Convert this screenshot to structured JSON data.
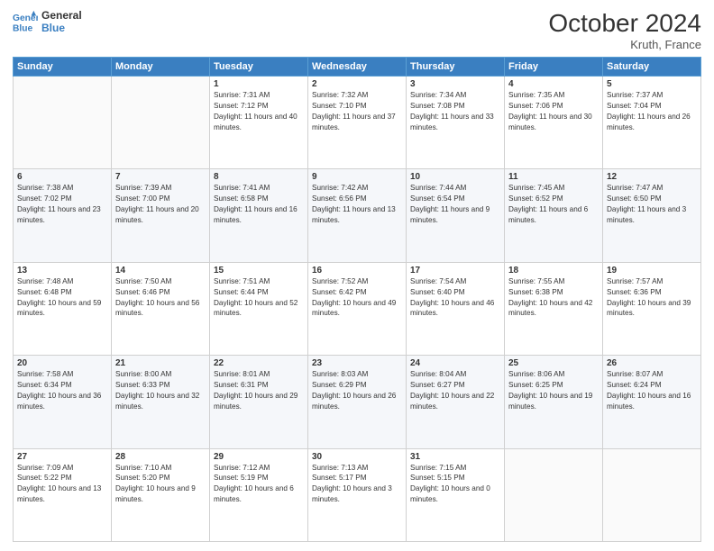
{
  "header": {
    "logo_line1": "General",
    "logo_line2": "Blue",
    "month_title": "October 2024",
    "location": "Kruth, France"
  },
  "weekdays": [
    "Sunday",
    "Monday",
    "Tuesday",
    "Wednesday",
    "Thursday",
    "Friday",
    "Saturday"
  ],
  "weeks": [
    [
      {
        "day": "",
        "info": ""
      },
      {
        "day": "",
        "info": ""
      },
      {
        "day": "1",
        "info": "Sunrise: 7:31 AM\nSunset: 7:12 PM\nDaylight: 11 hours and 40 minutes."
      },
      {
        "day": "2",
        "info": "Sunrise: 7:32 AM\nSunset: 7:10 PM\nDaylight: 11 hours and 37 minutes."
      },
      {
        "day": "3",
        "info": "Sunrise: 7:34 AM\nSunset: 7:08 PM\nDaylight: 11 hours and 33 minutes."
      },
      {
        "day": "4",
        "info": "Sunrise: 7:35 AM\nSunset: 7:06 PM\nDaylight: 11 hours and 30 minutes."
      },
      {
        "day": "5",
        "info": "Sunrise: 7:37 AM\nSunset: 7:04 PM\nDaylight: 11 hours and 26 minutes."
      }
    ],
    [
      {
        "day": "6",
        "info": "Sunrise: 7:38 AM\nSunset: 7:02 PM\nDaylight: 11 hours and 23 minutes."
      },
      {
        "day": "7",
        "info": "Sunrise: 7:39 AM\nSunset: 7:00 PM\nDaylight: 11 hours and 20 minutes."
      },
      {
        "day": "8",
        "info": "Sunrise: 7:41 AM\nSunset: 6:58 PM\nDaylight: 11 hours and 16 minutes."
      },
      {
        "day": "9",
        "info": "Sunrise: 7:42 AM\nSunset: 6:56 PM\nDaylight: 11 hours and 13 minutes."
      },
      {
        "day": "10",
        "info": "Sunrise: 7:44 AM\nSunset: 6:54 PM\nDaylight: 11 hours and 9 minutes."
      },
      {
        "day": "11",
        "info": "Sunrise: 7:45 AM\nSunset: 6:52 PM\nDaylight: 11 hours and 6 minutes."
      },
      {
        "day": "12",
        "info": "Sunrise: 7:47 AM\nSunset: 6:50 PM\nDaylight: 11 hours and 3 minutes."
      }
    ],
    [
      {
        "day": "13",
        "info": "Sunrise: 7:48 AM\nSunset: 6:48 PM\nDaylight: 10 hours and 59 minutes."
      },
      {
        "day": "14",
        "info": "Sunrise: 7:50 AM\nSunset: 6:46 PM\nDaylight: 10 hours and 56 minutes."
      },
      {
        "day": "15",
        "info": "Sunrise: 7:51 AM\nSunset: 6:44 PM\nDaylight: 10 hours and 52 minutes."
      },
      {
        "day": "16",
        "info": "Sunrise: 7:52 AM\nSunset: 6:42 PM\nDaylight: 10 hours and 49 minutes."
      },
      {
        "day": "17",
        "info": "Sunrise: 7:54 AM\nSunset: 6:40 PM\nDaylight: 10 hours and 46 minutes."
      },
      {
        "day": "18",
        "info": "Sunrise: 7:55 AM\nSunset: 6:38 PM\nDaylight: 10 hours and 42 minutes."
      },
      {
        "day": "19",
        "info": "Sunrise: 7:57 AM\nSunset: 6:36 PM\nDaylight: 10 hours and 39 minutes."
      }
    ],
    [
      {
        "day": "20",
        "info": "Sunrise: 7:58 AM\nSunset: 6:34 PM\nDaylight: 10 hours and 36 minutes."
      },
      {
        "day": "21",
        "info": "Sunrise: 8:00 AM\nSunset: 6:33 PM\nDaylight: 10 hours and 32 minutes."
      },
      {
        "day": "22",
        "info": "Sunrise: 8:01 AM\nSunset: 6:31 PM\nDaylight: 10 hours and 29 minutes."
      },
      {
        "day": "23",
        "info": "Sunrise: 8:03 AM\nSunset: 6:29 PM\nDaylight: 10 hours and 26 minutes."
      },
      {
        "day": "24",
        "info": "Sunrise: 8:04 AM\nSunset: 6:27 PM\nDaylight: 10 hours and 22 minutes."
      },
      {
        "day": "25",
        "info": "Sunrise: 8:06 AM\nSunset: 6:25 PM\nDaylight: 10 hours and 19 minutes."
      },
      {
        "day": "26",
        "info": "Sunrise: 8:07 AM\nSunset: 6:24 PM\nDaylight: 10 hours and 16 minutes."
      }
    ],
    [
      {
        "day": "27",
        "info": "Sunrise: 7:09 AM\nSunset: 5:22 PM\nDaylight: 10 hours and 13 minutes."
      },
      {
        "day": "28",
        "info": "Sunrise: 7:10 AM\nSunset: 5:20 PM\nDaylight: 10 hours and 9 minutes."
      },
      {
        "day": "29",
        "info": "Sunrise: 7:12 AM\nSunset: 5:19 PM\nDaylight: 10 hours and 6 minutes."
      },
      {
        "day": "30",
        "info": "Sunrise: 7:13 AM\nSunset: 5:17 PM\nDaylight: 10 hours and 3 minutes."
      },
      {
        "day": "31",
        "info": "Sunrise: 7:15 AM\nSunset: 5:15 PM\nDaylight: 10 hours and 0 minutes."
      },
      {
        "day": "",
        "info": ""
      },
      {
        "day": "",
        "info": ""
      }
    ]
  ]
}
